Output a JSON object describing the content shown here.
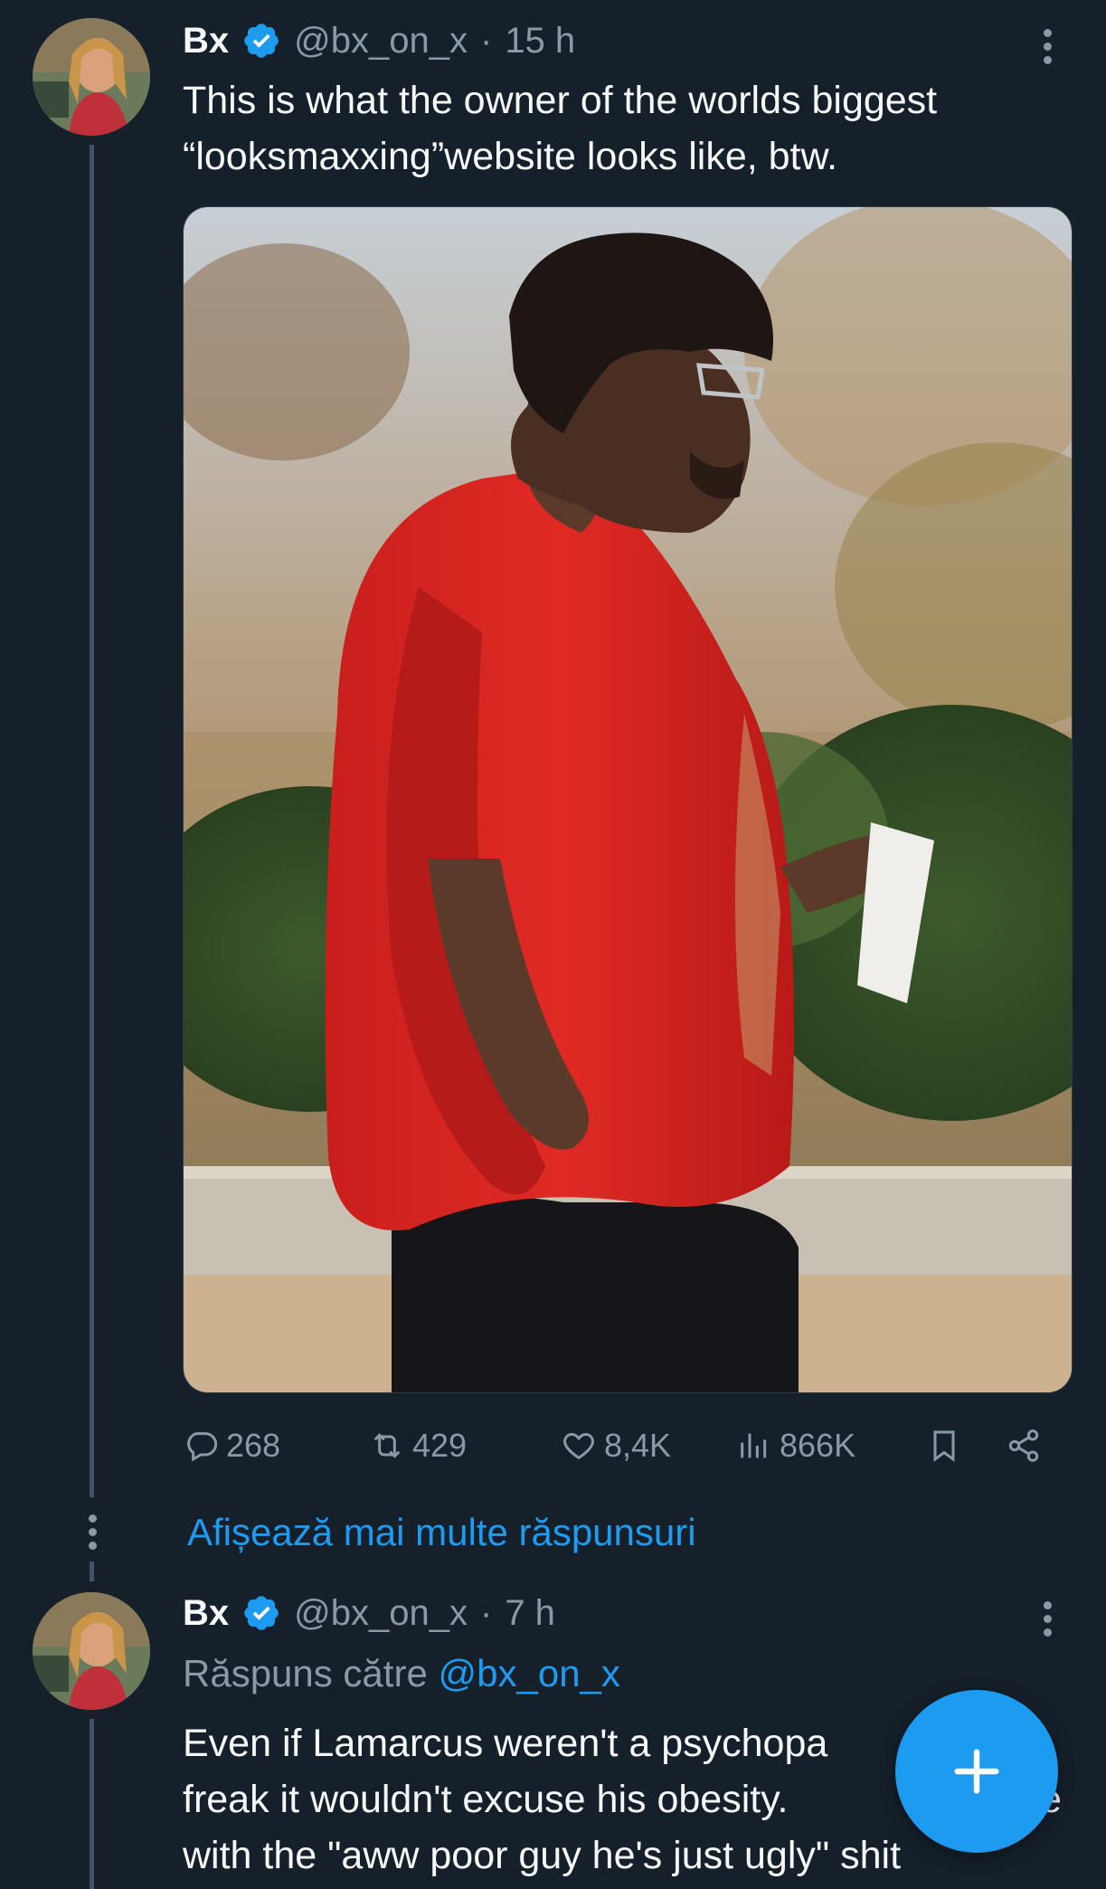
{
  "tweet1": {
    "author_name": "Bx",
    "handle": "@bx_on_x",
    "separator": "·",
    "time": "15 h",
    "text_line1": "This is what the owner of the worlds biggest",
    "text_line2": "“looksmaxxing”website looks like, btw.",
    "stats": {
      "replies": "268",
      "reposts": "429",
      "likes": "8,4K",
      "views": "866K"
    }
  },
  "show_more_replies": "Afișează mai multe răspunsuri",
  "tweet2": {
    "author_name": "Bx",
    "handle": "@bx_on_x",
    "separator": "·",
    "time": "7 h",
    "reply_to_label": "Răspuns către",
    "reply_to_handle": "@bx_on_x",
    "text_line1": "Even if Lamarcus weren't a psychopa",
    "text_line2": "freak it wouldn't excuse his obesity.",
    "text_line2_tail": "e",
    "text_line3": "with the \"aww poor guy he's just ugly\" shit"
  },
  "colors": {
    "background": "#15202b",
    "text": "#f7f9f9",
    "secondary": "#8b98a5",
    "accent": "#1d9bf0"
  },
  "icons": [
    "verified-badge-icon",
    "more-vertical-icon",
    "reply-icon",
    "repost-icon",
    "like-icon",
    "views-icon",
    "bookmark-icon",
    "share-icon",
    "plus-icon"
  ]
}
